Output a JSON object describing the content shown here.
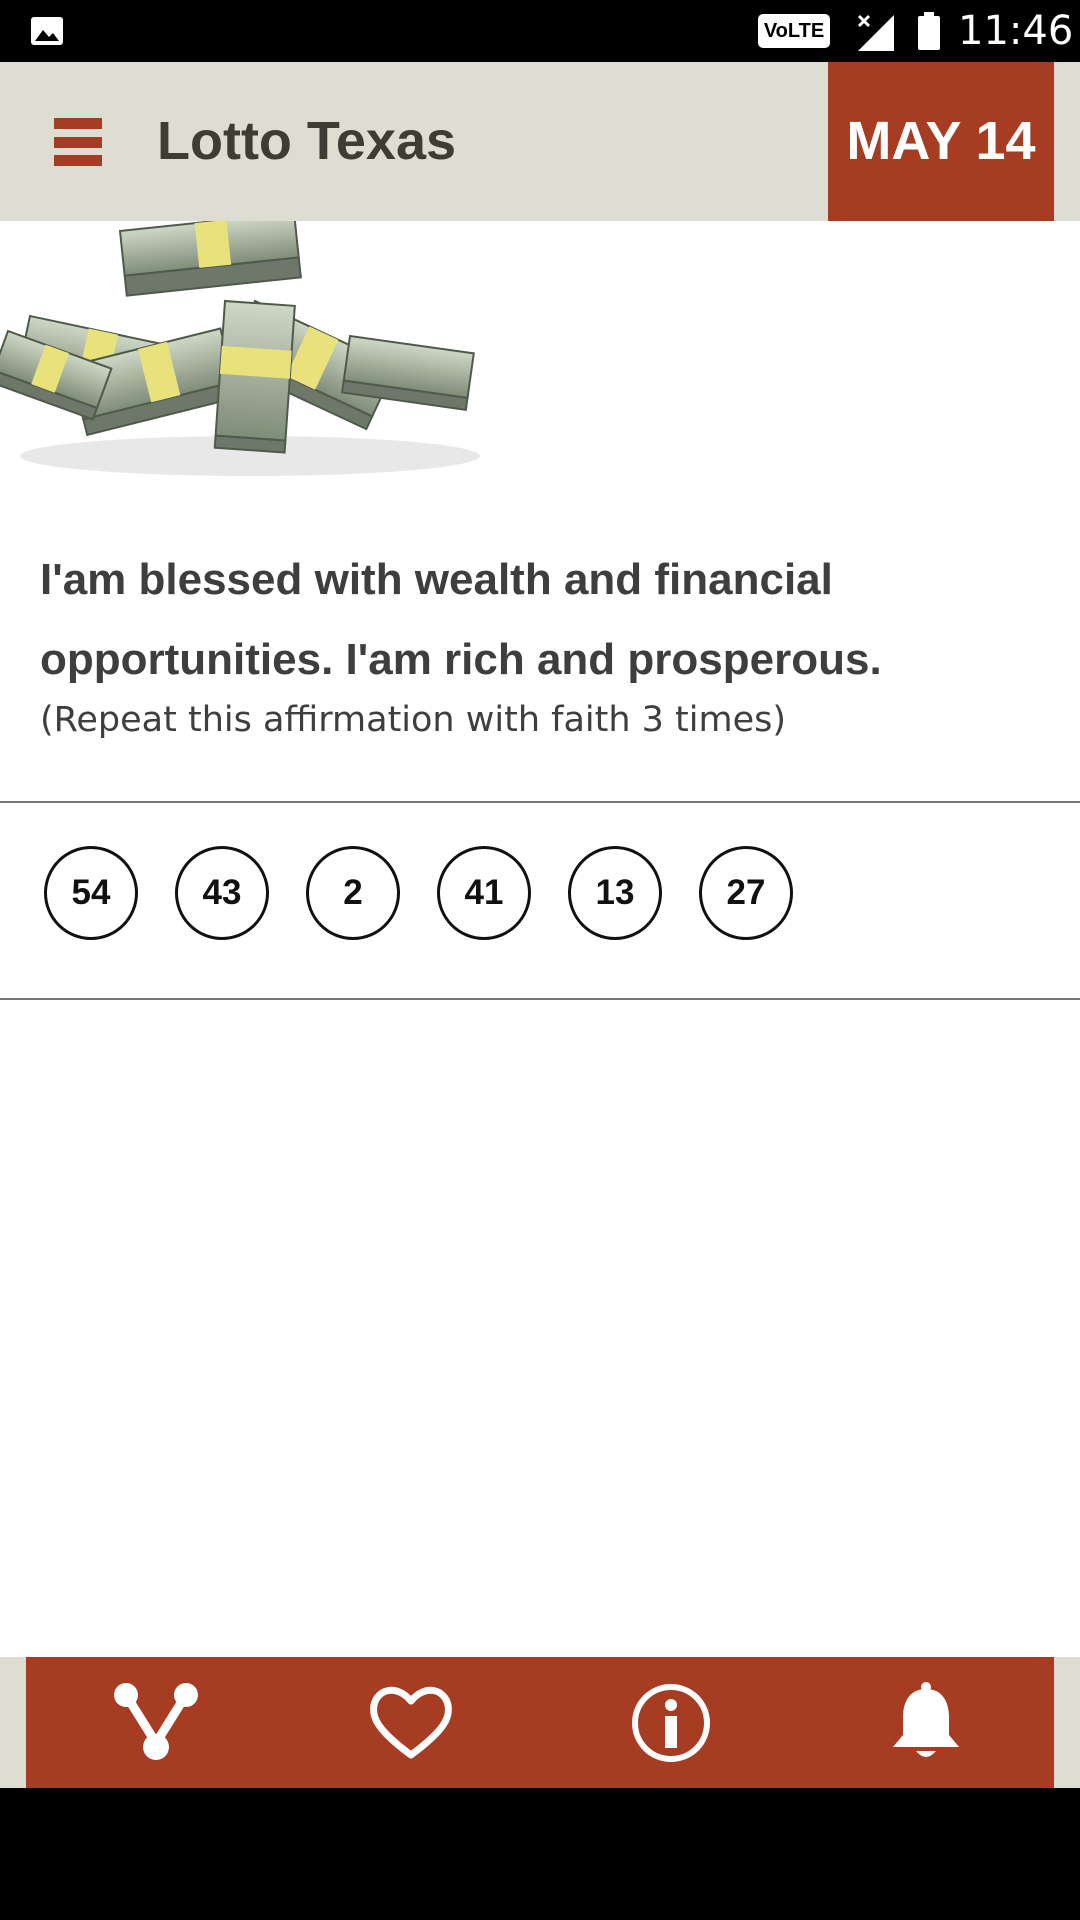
{
  "status_bar": {
    "volte": "VoLTE",
    "time": "11:46",
    "icons": [
      "gallery-icon",
      "signal-icon",
      "battery-icon"
    ]
  },
  "app_bar": {
    "menu_icon": "hamburger-menu-icon",
    "title": "Lotto Texas",
    "date": "MAY 14"
  },
  "affirmation": {
    "text": "I'am blessed with wealth and financial opportunities. I'am rich and prosperous.",
    "note": "(Repeat this affirmation with faith 3 times)"
  },
  "numbers": [
    "54",
    "43",
    "2",
    "41",
    "13",
    "27"
  ],
  "bottom_nav": {
    "items": [
      "share-icon",
      "heart-icon",
      "info-icon",
      "bell-icon"
    ]
  },
  "colors": {
    "accent": "#a63c22",
    "app_bar_bg": "#ddddd1",
    "text": "#3e3e3e"
  }
}
